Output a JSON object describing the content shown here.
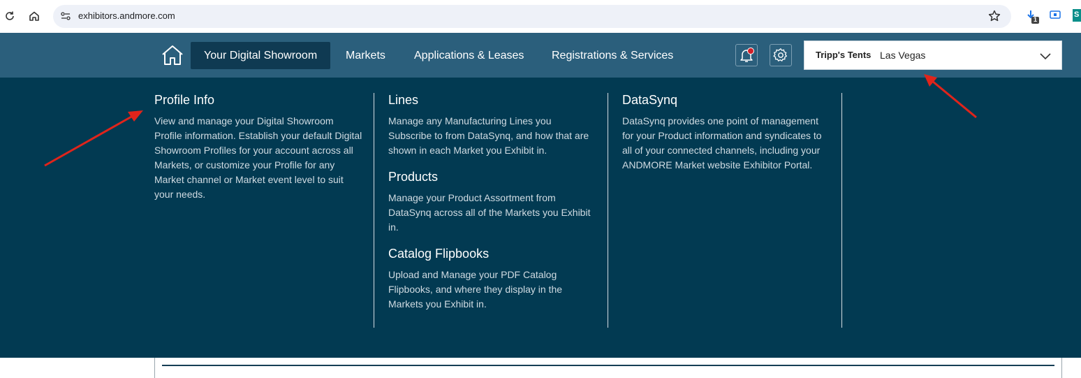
{
  "browser": {
    "url": "exhibitors.andmore.com",
    "extension_badge": "1",
    "extension_letter": "S"
  },
  "nav": {
    "items": [
      {
        "label": "Your Digital Showroom",
        "active": true
      },
      {
        "label": "Markets",
        "active": false
      },
      {
        "label": "Applications & Leases",
        "active": false
      },
      {
        "label": "Registrations & Services",
        "active": false
      }
    ],
    "selector": {
      "company": "Tripp's Tents",
      "location": "Las Vegas"
    }
  },
  "menu": {
    "columns": [
      {
        "sections": [
          {
            "title": "Profile Info",
            "description": "View and manage your Digital Showroom Profile information. Establish your default Digital Showroom Profiles for your account across all Markets, or customize your Profile for any Market channel or Market event level to suit your needs."
          }
        ]
      },
      {
        "sections": [
          {
            "title": "Lines",
            "description": "Manage any Manufacturing Lines you Subscribe to from DataSynq, and how that are shown in each Market you Exhibit in."
          },
          {
            "title": "Products",
            "description": "Manage your Product Assortment from DataSynq across all of the Markets you Exhibit in."
          },
          {
            "title": "Catalog Flipbooks",
            "description": "Upload and Manage your PDF Catalog Flipbooks, and where they display in the Markets you Exhibit in."
          }
        ]
      },
      {
        "sections": [
          {
            "title": "DataSynq",
            "description": "DataSynq provides one point of management for your Product information and syndicates to all of your connected channels, including your ANDMORE Market website Exhibitor Portal."
          }
        ]
      }
    ]
  },
  "colors": {
    "nav_bg": "#2b5f7c",
    "panel_bg": "#023a52",
    "active_tab": "#0f3a52",
    "annotation_arrow": "#e0241b",
    "notification_dot": "#d0202a"
  }
}
